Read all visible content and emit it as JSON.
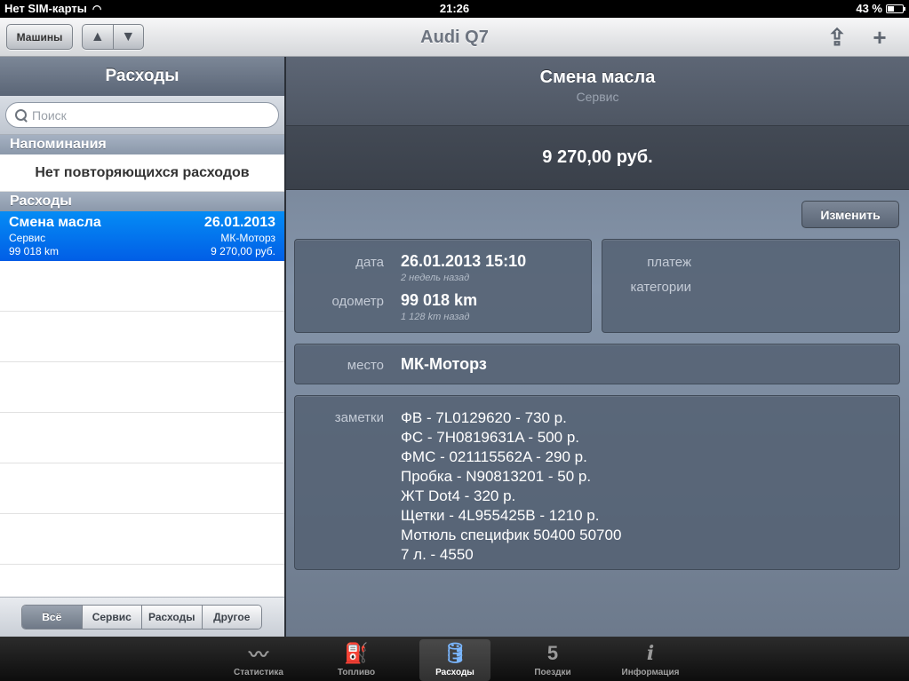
{
  "status": {
    "carrier": "Нет SIM-карты",
    "time": "21:26",
    "battery": "43 %",
    "battery_level": 0.43
  },
  "nav": {
    "title": "Audi Q7",
    "cars_button": "Машины",
    "up_glyph": "▲",
    "down_glyph": "▼",
    "share_glyph": "⇪",
    "plus_glyph": "+"
  },
  "sidebar": {
    "title": "Расходы",
    "search_placeholder": "Поиск",
    "reminders_header": "Напоминания",
    "reminders_empty": "Нет повторяющихся расходов",
    "expenses_header": "Расходы",
    "expenses": [
      {
        "name": "Смена масла",
        "date": "26.01.2013",
        "category": "Сервис",
        "place": "МК-Моторз",
        "odometer": "99 018 km",
        "price": "9 270,00 руб."
      }
    ],
    "filters": [
      "Всё",
      "Сервис",
      "Расходы",
      "Другое"
    ],
    "active_filter": 0
  },
  "detail": {
    "title": "Смена масла",
    "subtitle": "Сервис",
    "price": "9 270,00 руб.",
    "edit_button": "Изменить",
    "date_label": "дата",
    "date_value": "26.01.2013 15:10",
    "date_hint": "2 недель назад",
    "odometer_label": "одометр",
    "odometer_value": "99 018 km",
    "odometer_hint": "1 128 km назад",
    "payment_label": "платеж",
    "category_label": "категории",
    "place_label": "место",
    "place_value": "МК-Моторз",
    "notes_label": "заметки",
    "notes": [
      "ФВ - 7L0129620 - 730 р.",
      "ФС - 7H0819631A - 500 р.",
      "ФМС - 021115562A - 290 р.",
      "Пробка - N90813201 - 50 р.",
      "ЖТ Dot4 - 320 р.",
      "Щетки - 4L955425B - 1210 р.",
      "Мотюль специфик 50400 50700",
      "7 л. - 4550"
    ]
  },
  "tabs": [
    {
      "label": "Статистика",
      "icon": "statistics-icon",
      "glyph": "〰"
    },
    {
      "label": "Топливо",
      "icon": "fuel-pump-icon",
      "glyph": "⛽"
    },
    {
      "label": "Расходы",
      "icon": "oil-can-icon",
      "glyph": "🛢"
    },
    {
      "label": "Поездки",
      "icon": "route-shield-icon",
      "glyph": "5"
    },
    {
      "label": "Информация",
      "icon": "info-icon",
      "glyph": "i"
    }
  ],
  "active_tab": 2
}
